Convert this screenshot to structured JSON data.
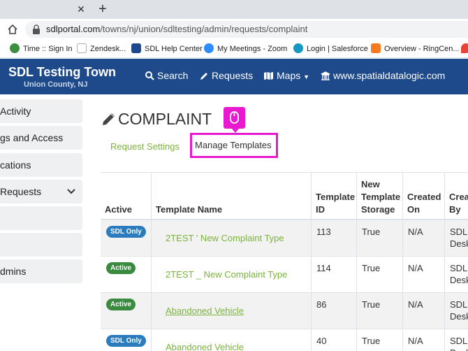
{
  "browser": {
    "tab_close": "✕",
    "new_tab": "+",
    "url_host": "sdlportal.com",
    "url_path": "/towns/nj/union/sdltesting/admin/requests/complaint",
    "bookmarks": [
      {
        "label": "Time :: Sign In",
        "color": "#3b8f3e"
      },
      {
        "label": "Zendesk...",
        "color": "#ffffff"
      },
      {
        "label": "SDL Help Center",
        "color": "#1e4a8c"
      },
      {
        "label": "My Meetings - Zoom",
        "color": "#2d8cff"
      },
      {
        "label": "Login | Salesforce",
        "color": "#1798c1"
      },
      {
        "label": "Overview - RingCen...",
        "color": "#f47b20"
      }
    ]
  },
  "app": {
    "title": "SDL Testing Town",
    "subtitle": "Union County, NJ",
    "nav": {
      "search": "Search",
      "requests": "Requests",
      "maps": "Maps",
      "website": "www.spatialdatalogic.com"
    }
  },
  "sidebar": {
    "items": [
      {
        "label": "Activity"
      },
      {
        "label": "gs and Access"
      },
      {
        "label": "cations"
      },
      {
        "label": "Requests"
      },
      {
        "label": ""
      },
      {
        "label": ""
      },
      {
        "label": "dmins"
      }
    ]
  },
  "main": {
    "title": "COMPLAINT",
    "tabs": {
      "request_settings": "Request Settings",
      "manage_templates": "Manage Templates"
    }
  },
  "table": {
    "headers": {
      "active": "Active",
      "template_name": "Template Name",
      "template_id": "Template ID",
      "new_storage": "New Template Storage",
      "created_on": "Created On",
      "created_by": "Crea By"
    },
    "rows": [
      {
        "badge": "SDL Only",
        "name": "2TEST ' New Complaint Type",
        "id": "113",
        "storage": "True",
        "created_on": "N/A",
        "created_by": "SDL Desk"
      },
      {
        "badge": "Active",
        "name": "2TEST _ New Complaint Type",
        "id": "114",
        "storage": "True",
        "created_on": "N/A",
        "created_by": "SDL Desk"
      },
      {
        "badge": "Active",
        "name": "Abandoned Vehicle",
        "id": "86",
        "storage": "True",
        "created_on": "N/A",
        "created_by": "SDL Desk"
      },
      {
        "badge": "SDL Only",
        "name": "Abandoned Vehicle",
        "id": "40",
        "storage": "True",
        "created_on": "N/A",
        "created_by": "SDL Desk"
      }
    ]
  },
  "colors": {
    "header_bg": "#1e4a8c",
    "accent_green": "#7ab33b",
    "highlight_magenta": "#e81ad0",
    "badge_blue": "#2b7bbf",
    "badge_green": "#3a8a40"
  }
}
